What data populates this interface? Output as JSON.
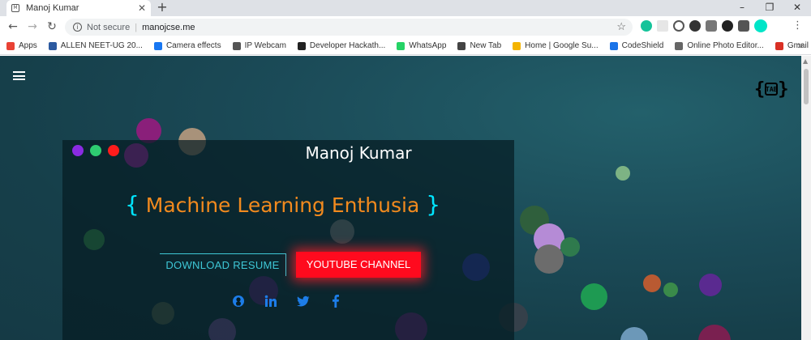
{
  "browser": {
    "tab_title": "Manoj Kumar",
    "tab_favicon": "M",
    "new_tab_symbol": "+",
    "close_symbol": "✕",
    "not_secure": "Not secure",
    "url": "manojcse.me"
  },
  "bookmarks": [
    {
      "label": "Apps",
      "color": "#e94235"
    },
    {
      "label": "ALLEN NEET-UG 20...",
      "color": "#2c5aa0"
    },
    {
      "label": "Camera effects",
      "color": "#1877f2"
    },
    {
      "label": "IP Webcam",
      "color": "#555555"
    },
    {
      "label": "Developer Hackath...",
      "color": "#222222"
    },
    {
      "label": "WhatsApp",
      "color": "#25d366"
    },
    {
      "label": "New Tab",
      "color": "#444444"
    },
    {
      "label": "Home | Google Su...",
      "color": "#f4b400"
    },
    {
      "label": "CodeShield",
      "color": "#1a73e8"
    },
    {
      "label": "Online Photo Editor...",
      "color": "#666666"
    },
    {
      "label": "Gmail",
      "color": "#d93025"
    }
  ],
  "page": {
    "name": "Manoj Kumar",
    "brace_open": "{",
    "tagline": "Machine Learning Enthusia",
    "brace_close": "}",
    "download_label": "DOWNLOAD RESUME",
    "youtube_label": "YOUTUBE CHANNEL",
    "logo_text": "TAB"
  },
  "colors": {
    "accent_cyan": "#3ec7d6",
    "tagline_orange": "#f28a1e",
    "youtube_red": "#ff0a1e",
    "dot_purple": "#8a2be2",
    "dot_green": "#2ecc71",
    "dot_red": "#ff1c1c"
  },
  "icons": [
    "github-icon",
    "linkedin-icon",
    "twitter-icon",
    "facebook-icon"
  ]
}
